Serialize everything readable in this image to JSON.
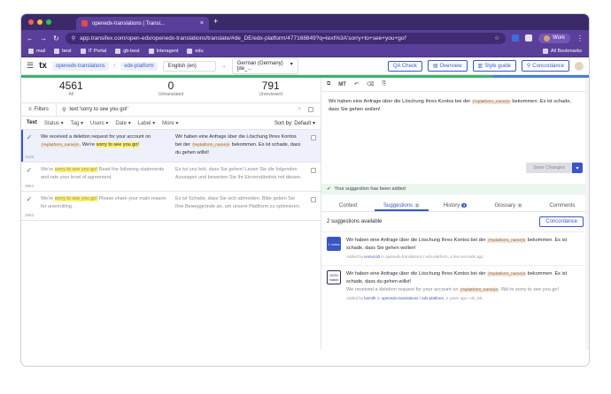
{
  "browser": {
    "tab_title": "openedx-translations | Transi...",
    "url": "app.transifex.com/open-edx/openedx-translations/translate/#de_DE/edx-platform/477168849?q=text%3A'sorry+to+see+you+go!'",
    "profile": "Work",
    "bookmarks": [
      "mail",
      "best",
      "IT Portal",
      "gb-best",
      "Interagent",
      "edu"
    ],
    "all_bookmarks": "All Bookmarks"
  },
  "header": {
    "logo": "tx",
    "project": "openedx-translations",
    "resource": "edx-platform",
    "source_lang": "English (en)",
    "target_lang": "German (Germany) [de_...",
    "qa_check": "QA Check",
    "overview": "Overview",
    "style_guide": "Style guide",
    "concordance": "Concordance"
  },
  "stats": [
    {
      "num": "4561",
      "label": "All"
    },
    {
      "num": "0",
      "label": "Untranslated"
    },
    {
      "num": "791",
      "label": "Unreviewed"
    }
  ],
  "filter": {
    "button": "Filters",
    "query": "text:'sorry to see you go!'"
  },
  "sortbar": {
    "items": [
      "Text",
      "Status",
      "Tag",
      "Users",
      "Date",
      "Label",
      "More"
    ],
    "sort": "Sort by: Default"
  },
  "rows": [
    {
      "id": "1515",
      "src_pre": "We received a deletion request for your account on",
      "src_ph": "{%platform_name}s",
      "src_mid": ". We're",
      "src_hl": "sorry to see you go!",
      "trg_pre": "Wir haben eine Anfrage über die Löschung Ihres Kontos bei der",
      "trg_ph": "{%platform_name}s",
      "trg_post": "bekommen. Es ist schade, dass du gehen willst!"
    },
    {
      "id": "3954",
      "src_pre": "We're",
      "src_hl": "sorry to see you go!",
      "src_post": "Read the following statements and rate your level of agreement.",
      "trg": "Es tut uns leid, dass Sie gehen! Lesen Sie die folgenden Aussagen und bewerten Sie Ihr Einverständnis mit diesen."
    },
    {
      "id": "3963",
      "src_pre": "We're",
      "src_hl": "sorry to see you go!",
      "src_post": "Please share your main reason for unenrolling.",
      "trg": "Es ist Schade, dass Sie sich abmelden. Bitte geben Sie Ihre Beweggründe an, um unsere Plattform zu optimieren."
    }
  ],
  "editor": {
    "pre": "Wir haben eine Anfrage über die Löschung Ihres Kontos bei der",
    "ph": "{%platform_name}s",
    "post": "bekommen. Es ist schade, dass Sie gehen wollen!",
    "save": "Save Changes"
  },
  "toast": "Your suggestion has been added",
  "rtabs": [
    {
      "label": "Context"
    },
    {
      "label": "Suggestions",
      "badge": "2"
    },
    {
      "label": "History",
      "badge": "3"
    },
    {
      "label": "Glossary",
      "badge": "0"
    },
    {
      "label": "Comments"
    }
  ],
  "suggestions": {
    "count_text": "2 suggestions available",
    "concordance": "Concordance",
    "items": [
      {
        "icon": "1 votes",
        "pre": "Wir haben eine Anfrage über die Löschung Ihres Kontos bei der",
        "ph": "{%platform_name}s",
        "post": "bekommen. Es ist schade, dass Sie gehen wollen!",
        "meta_pre": "Added by",
        "meta_user": "ivonscott",
        "meta_post": "in openedx-translations / edx-platform, a few seconds ago"
      },
      {
        "icon": "100% match",
        "pre": "Wir haben eine Anfrage über die Löschung Ihres Kontos bei der",
        "ph": "{%platform_name}s",
        "post": "bekommen. Es ist schade, dass du gehen willst!",
        "src_pre": "We received a deletion request for your account on",
        "src_ph": "{%platform_name}s",
        "src_post": ". We're sorry to see you go!",
        "meta_pre": "Added by",
        "meta_user": "bsmith",
        "meta_mid": "in",
        "meta_link": "openedx-translations / edx-platform",
        "meta_post": ", 2 years ago • de_DE"
      }
    ]
  },
  "colors": {
    "progress_green": "#3bb36b",
    "progress_blue": "#4a7ee0",
    "accent": "#3a56c5"
  }
}
